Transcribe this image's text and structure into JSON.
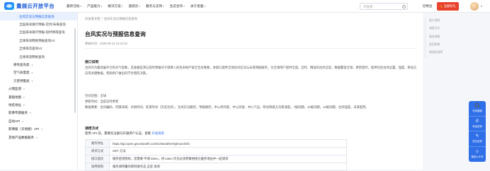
{
  "header": {
    "logo": "量展云开放平台",
    "nav": [
      {
        "label": "最新活动"
      },
      {
        "label": "产品能力"
      },
      {
        "label": "解决方案"
      },
      {
        "label": "遥感云"
      },
      {
        "label": "服务与支持"
      },
      {
        "label": "生态合作"
      },
      {
        "label": "关于星图"
      }
    ],
    "search_placeholder": "开发者",
    "console": "控制台",
    "gift": "注册有礼"
  },
  "sidebar": {
    "items": [
      {
        "label": "台风实况与预报信息查询",
        "type": "sub",
        "active": true
      },
      {
        "label": "全国海洋潮汐预报-实时/未来查询",
        "type": "sub"
      },
      {
        "label": "全国海洋潮汐预报-短时降雨查询",
        "type": "sub"
      },
      {
        "label": "全球海洋网格预报查询V2",
        "type": "sub"
      },
      {
        "label": "全球海流查询V2",
        "type": "sub"
      },
      {
        "label": "全球海浪网格查询",
        "type": "sub"
      },
      {
        "label": "耕地查询类",
        "type": "sub2",
        "chev": true
      },
      {
        "label": "空气质量类",
        "type": "sub2",
        "chev": true
      },
      {
        "label": "灾害预警类",
        "type": "sub2",
        "chev": true
      },
      {
        "label": "火情监测",
        "type": "top",
        "chev": true
      },
      {
        "label": "基础地图",
        "type": "top",
        "chev": true
      },
      {
        "label": "地名地址",
        "type": "top",
        "chev": true
      },
      {
        "label": "影像专题服务",
        "type": "top",
        "chev": true
      },
      {
        "label": "自动API",
        "type": "top",
        "chev": true
      },
      {
        "label": "影像服（天地图）API",
        "type": "top",
        "chev": true
      },
      {
        "label": "其他产品数据服务",
        "type": "top",
        "chev": true
      }
    ]
  },
  "main": {
    "breadcrumb": [
      "开发者文档",
      "台风实况与预报信息查询"
    ],
    "title": "台风实况与预报信息查询",
    "update_time": "更新时间：2025-06-13 15:12:32",
    "intro_title": "接口说明",
    "intro_text": "台风作为最具破坏力的天气现象，其准确监测与及时预报对于保障人民生命财产安全至关重要。本接口提供全球台风实况与未来预报服务，为全球用户提供全面、实时、精准的台风信息，数据覆盖全球，更新及时，提供包括台风位置、强度、移动方向等关键数据，帮助用户做出科学合理的决策。",
    "coverage": "空间范围：全球",
    "frequency": "更新时间：当前实时更新",
    "elements": "数据要素：台风编码、所属海域、开始时间、结束时间（历史台风），台风实况路径，预报路径，中心经纬度、中心风速、中心气压、移动等级方向和速度，7级风圈，10级风圈，12级风圈，台风强度，未来趋势。",
    "usage_title": "调用方式",
    "usage_line_prefix": "使用 API 前，需要先注册号开通用户认证，查看",
    "usage_link": "开发指南",
    "table": [
      {
        "key": "服务地址",
        "value": "https://api.open.geovisearth.com/v2/weather/typhoon/info"
      },
      {
        "key": "请求方式",
        "value": "GET 方法"
      },
      {
        "key": "接口鉴权",
        "value": "服务密钥授权，您需要 申请 token，将 token 作为必须参数拼接在服务地址中一起请求"
      },
      {
        "key": "调用限制",
        "value": "服务调用量的限制请点击 这里 查阅"
      }
    ]
  },
  "toc": [
    "接口说明",
    "调用方式",
    "请求参数",
    "返回结果",
    "错误码说明"
  ],
  "float": [
    {
      "label": "在线客服",
      "icon": "headset-icon"
    },
    {
      "label": "电话咨询",
      "icon": "phone-icon"
    },
    {
      "label": "意见反馈",
      "icon": "feedback-icon"
    },
    {
      "label": "微信公众号",
      "icon": "wechat-icon"
    }
  ]
}
